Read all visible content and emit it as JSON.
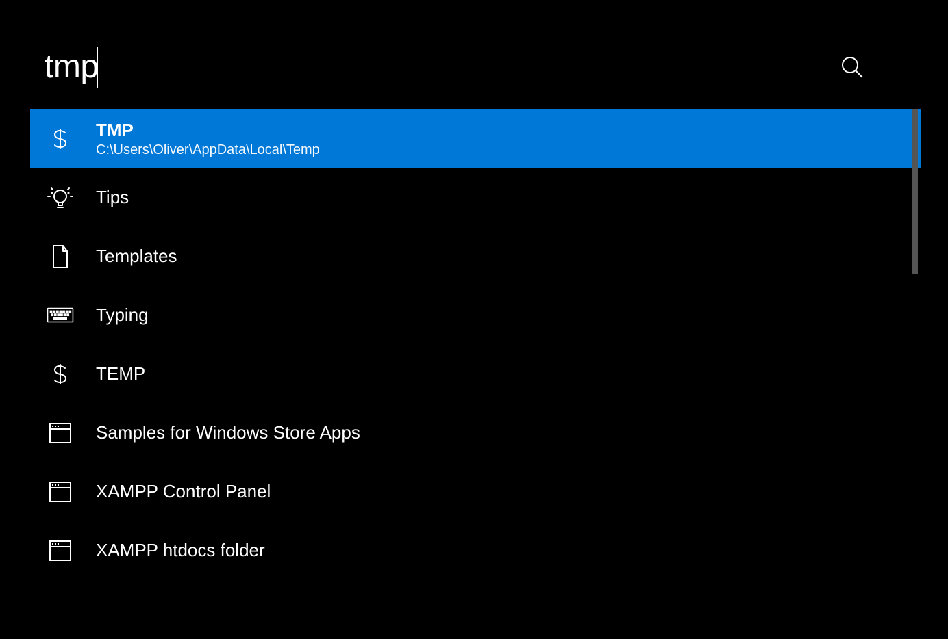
{
  "search": {
    "query": "tmp"
  },
  "colors": {
    "selected": "#0078d7",
    "background": "#000000",
    "text": "#ffffff"
  },
  "results": [
    {
      "icon": "dollar",
      "title": "TMP",
      "subtitle": "C:\\Users\\Oliver\\AppData\\Local\\Temp",
      "selected": true
    },
    {
      "icon": "lightbulb",
      "title": "Tips",
      "subtitle": "",
      "selected": false
    },
    {
      "icon": "file",
      "title": "Templates",
      "subtitle": "",
      "selected": false
    },
    {
      "icon": "keyboard",
      "title": "Typing",
      "subtitle": "",
      "selected": false
    },
    {
      "icon": "dollar",
      "title": "TEMP",
      "subtitle": "",
      "selected": false
    },
    {
      "icon": "window",
      "title": "Samples for Windows Store Apps",
      "subtitle": "",
      "selected": false
    },
    {
      "icon": "window",
      "title": "XAMPP Control Panel",
      "subtitle": "",
      "selected": false
    },
    {
      "icon": "window",
      "title": "XAMPP htdocs folder",
      "subtitle": "",
      "selected": false
    }
  ]
}
